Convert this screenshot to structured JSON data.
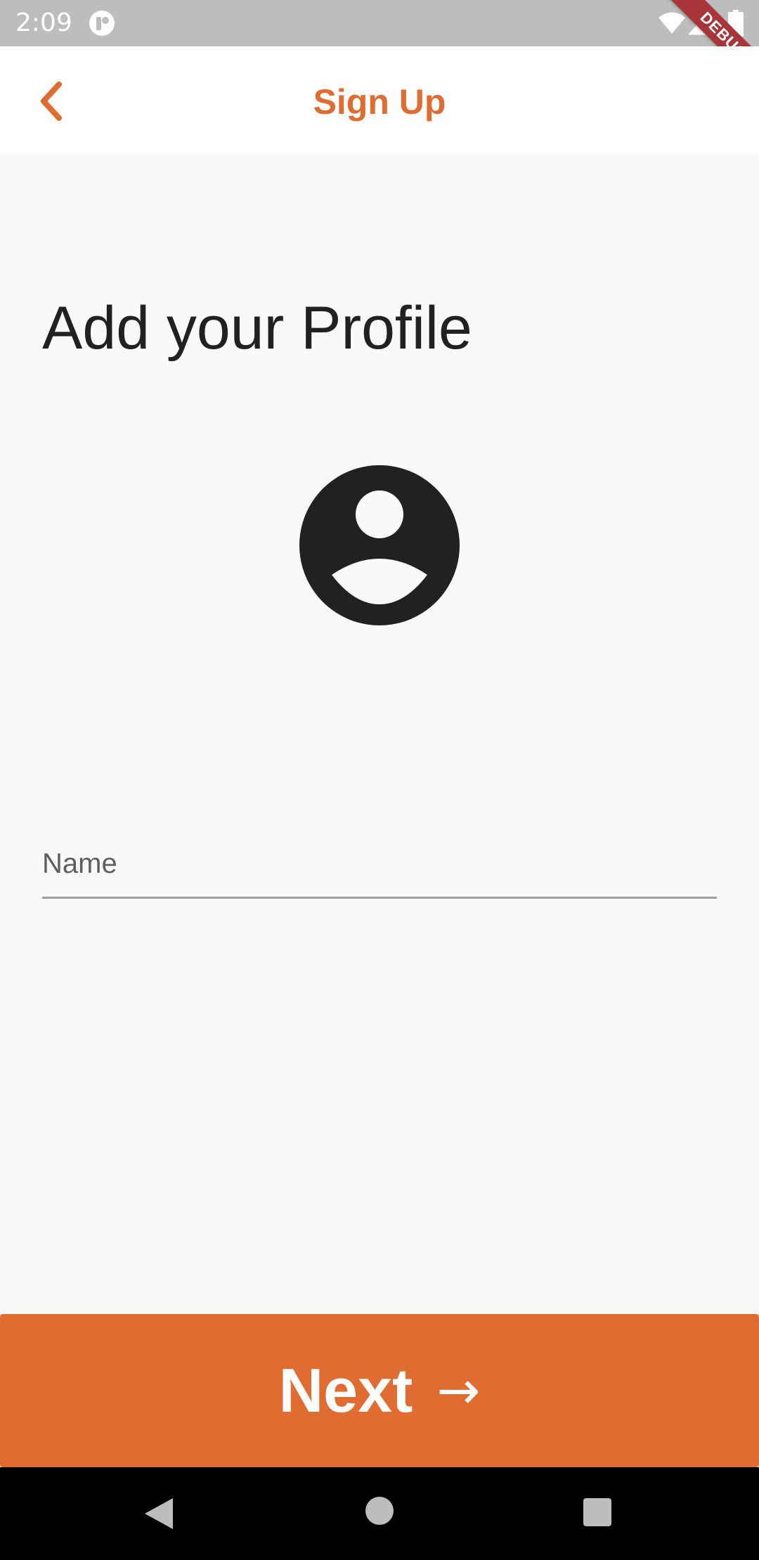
{
  "status_bar": {
    "time": "2:09",
    "icons": [
      "app-notification-icon",
      "wifi-icon",
      "signal-icon",
      "battery-icon"
    ]
  },
  "debug_banner": {
    "label": "DEBUG",
    "color": "#a8353a"
  },
  "app_bar": {
    "title": "Sign Up",
    "back_icon": "chevron-left-icon",
    "accent_color": "#e06c31"
  },
  "main": {
    "heading": "Add your Profile",
    "avatar_icon": "account-circle-icon",
    "name_field": {
      "placeholder": "Name",
      "value": ""
    }
  },
  "footer": {
    "next_label": "Next",
    "next_arrow": "→",
    "button_color": "#e06c31"
  },
  "nav_bar": {
    "icons": [
      "nav-back-icon",
      "nav-home-icon",
      "nav-recents-icon"
    ]
  }
}
